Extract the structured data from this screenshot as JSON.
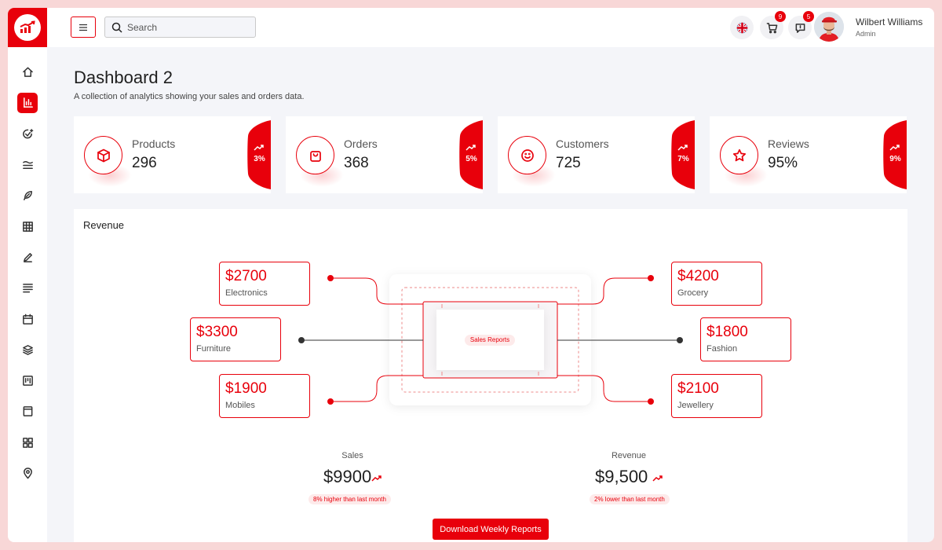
{
  "header": {
    "search_placeholder": "Search",
    "cart_badge": "9",
    "notifications_badge": "5",
    "user_name": "Wilbert Williams",
    "user_role": "Admin"
  },
  "page": {
    "title": "Dashboard 2",
    "subtitle": "A collection of analytics showing your sales and orders data."
  },
  "stats": [
    {
      "label": "Products",
      "value": "296",
      "change": "3%",
      "icon": "box-icon"
    },
    {
      "label": "Orders",
      "value": "368",
      "change": "5%",
      "icon": "shopping-bag-icon"
    },
    {
      "label": "Customers",
      "value": "725",
      "change": "7%",
      "icon": "smile-icon"
    },
    {
      "label": "Reviews",
      "value": "95%",
      "change": "9%",
      "icon": "star-icon"
    }
  ],
  "revenue": {
    "title": "Revenue",
    "center_label": "Sales Reports",
    "categories": [
      {
        "amount": "$2700",
        "name": "Electronics"
      },
      {
        "amount": "$3300",
        "name": "Furniture"
      },
      {
        "amount": "$1900",
        "name": "Mobiles"
      },
      {
        "amount": "$4200",
        "name": "Grocery"
      },
      {
        "amount": "$1800",
        "name": "Fashion"
      },
      {
        "amount": "$2100",
        "name": "Jewellery"
      }
    ],
    "sales": {
      "label": "Sales",
      "value": "$9900",
      "note": "8% higher than last month"
    },
    "revenue_total": {
      "label": "Revenue",
      "value": "$9,500",
      "note": "2% lower than last month"
    },
    "download_label": "Download Weekly Reports"
  },
  "colors": {
    "accent": "#e8000b",
    "background": "#f4f5f9",
    "outer": "#f8d7d7"
  }
}
